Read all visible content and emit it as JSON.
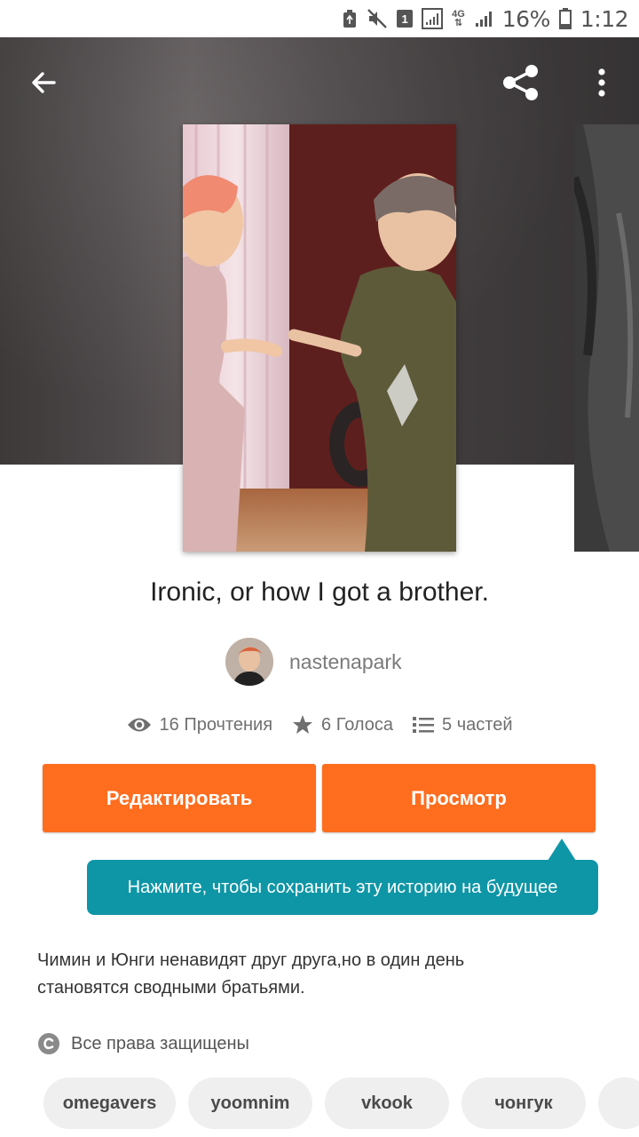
{
  "status_bar": {
    "net_label": "4G",
    "sim_label": "1",
    "battery": "16%",
    "time": "1:12"
  },
  "toolbar": {
    "back_icon": "arrow-left-icon",
    "share_icon": "share-icon",
    "more_icon": "more-vertical-icon"
  },
  "story": {
    "title": "Ironic, or how I got a brother.",
    "author": "nastenapark",
    "stats": {
      "reads": "16 Прочтения",
      "votes": "6 Голоса",
      "parts": "5 частей"
    },
    "description": "Чимин и Юнги ненавидят друг друга,но в один день становятся сводными братьями.",
    "rights": "Все права защищены",
    "tags": [
      "omegavers",
      "yoomnim",
      "vkook",
      "чонгук"
    ]
  },
  "actions": {
    "edit_label": "Редактировать",
    "view_label": "Просмотр"
  },
  "tooltip": {
    "text": "Нажмите, чтобы сохранить эту историю на будущее"
  },
  "colors": {
    "accent": "#ff6d1f",
    "tooltip": "#0e96a6",
    "header": "#4a4546"
  }
}
